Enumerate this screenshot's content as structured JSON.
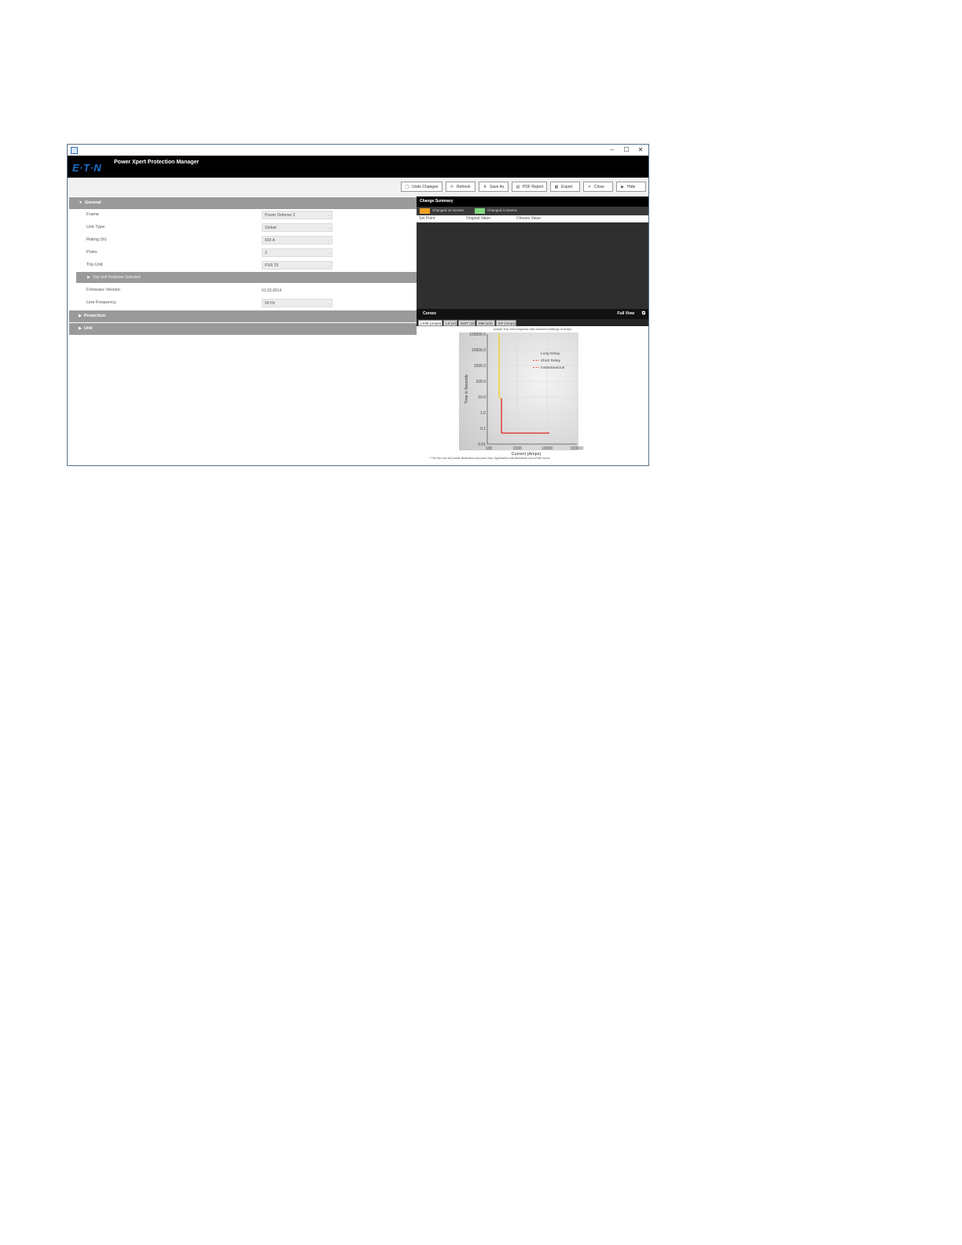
{
  "window": {
    "title_buttons": {
      "minimize": "–",
      "maximize": "☐",
      "close": "✕"
    }
  },
  "header": {
    "logo": "E·T·N",
    "app_title": "Power Xpert Protection Manager"
  },
  "toolbar": {
    "buttons": [
      {
        "label": "Undo Changes",
        "icon": "undo-icon",
        "glyph": "◯"
      },
      {
        "label": "Refresh",
        "icon": "refresh-icon",
        "glyph": "⟳"
      },
      {
        "label": "Save As",
        "icon": "save-icon",
        "glyph": "⬇"
      },
      {
        "label": "PDF Report",
        "icon": "pdf-icon",
        "glyph": "▤"
      },
      {
        "label": "Export",
        "icon": "export-icon",
        "glyph": "▦"
      },
      {
        "label": "Close",
        "icon": "close-icon",
        "glyph": "✕"
      },
      {
        "label": "Hide",
        "icon": "play-icon",
        "glyph": "▶"
      }
    ]
  },
  "sections": {
    "general": "General",
    "trip_unit_features": "Trip Unit Features Selected",
    "protection": "Protection",
    "unit": "Unit"
  },
  "general_fields": {
    "frame": {
      "label": "Frame",
      "value": "Power Defense 2"
    },
    "unit_type": {
      "label": "Unit Type",
      "value": "Global"
    },
    "rating": {
      "label": "Rating (In)",
      "value": "600 A"
    },
    "poles": {
      "label": "Poles",
      "value": "3"
    },
    "trip_unit": {
      "label": "Trip Unit",
      "value": "PXR 25"
    },
    "firmware": {
      "label": "Firmware Version",
      "value": "01.03.0014"
    },
    "line_frequency": {
      "label": "Line Frequency",
      "value": "60 Hz"
    }
  },
  "change_summary": {
    "title": "Change Summary",
    "legend_screen": "Changed on Screen",
    "legend_device": "Changed in Device",
    "color_screen": "#f0a020",
    "color_device": "#7fd67f",
    "col_setpoint": "Set Point",
    "col_original": "Original Value",
    "col_chosen": "Chosen Value"
  },
  "curves": {
    "title": "Curves",
    "full_view": "Full View",
    "tabs": [
      "LSIM (Amps)",
      "LS (x/r)",
      "INST (x/n)",
      "MM (x/n)",
      "GF (Amps)"
    ],
    "chart_title": "Actual Trip Unit response with selected settings in Amps",
    "footnote": "* The trip unit set points illustration purpose only. Application will determine end of the curve."
  },
  "chart_data": {
    "type": "line",
    "xlabel": "Current (Amps)",
    "ylabel": "Time in Seconds",
    "x_scale": "log",
    "y_scale": "log",
    "xlim": [
      100,
      100000
    ],
    "ylim": [
      0.01,
      100000
    ],
    "x_ticks": [
      "100",
      "1000",
      "10000",
      "100000"
    ],
    "y_ticks": [
      "0.01",
      "0.1",
      "1.0",
      "10.0",
      "100.0",
      "1000.0",
      "10000.0",
      "100000.0"
    ],
    "grid": true,
    "legend_position": "top-right",
    "series": [
      {
        "name": "Long Delay",
        "color": "#f2d21b",
        "points": [
          [
            250,
            100000
          ],
          [
            250,
            10
          ],
          [
            270,
            8
          ],
          [
            300,
            8
          ]
        ]
      },
      {
        "name": "Short Delay",
        "color": "#e32222",
        "points": [
          [
            300,
            8
          ],
          [
            300,
            0.05
          ]
        ]
      },
      {
        "name": "Instantaneous",
        "color": "#e32222",
        "points": [
          [
            300,
            0.05
          ],
          [
            12000,
            0.05
          ]
        ]
      }
    ]
  }
}
